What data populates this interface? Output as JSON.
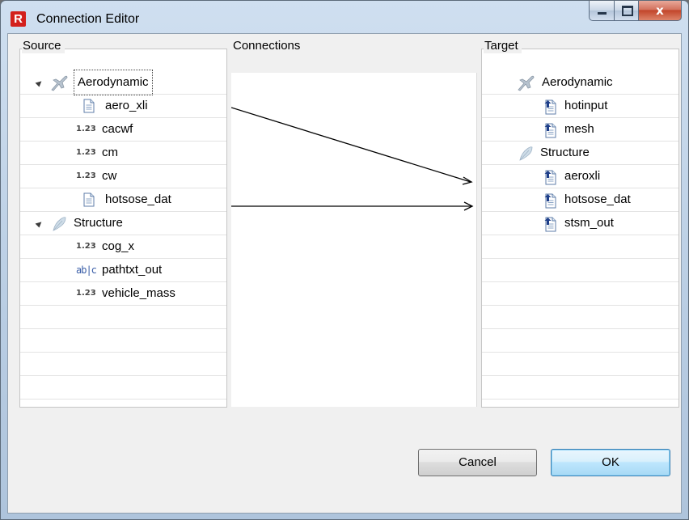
{
  "window": {
    "title": "Connection Editor",
    "app_icon_letter": "R",
    "close_glyph": "x"
  },
  "source": {
    "label": "Source",
    "items": [
      {
        "label": "Aerodynamic",
        "icon": "airplane-icon",
        "level": 0,
        "expanded": true,
        "focused": true
      },
      {
        "label": "aero_xli",
        "icon": "file-icon",
        "level": 1
      },
      {
        "label": "cacwf",
        "icon": "number-icon",
        "level": 1
      },
      {
        "label": "cm",
        "icon": "number-icon",
        "level": 1
      },
      {
        "label": "cw",
        "icon": "number-icon",
        "level": 1
      },
      {
        "label": "hotsose_dat",
        "icon": "file-icon",
        "level": 1
      },
      {
        "label": "Structure",
        "icon": "feather-icon",
        "level": 0,
        "expanded": true
      },
      {
        "label": "cog_x",
        "icon": "number-icon",
        "level": 1
      },
      {
        "label": "pathtxt_out",
        "icon": "text-icon",
        "level": 1
      },
      {
        "label": "vehicle_mass",
        "icon": "number-icon",
        "level": 1
      }
    ],
    "number_icon_text": "1.23",
    "text_icon_text": "ab|c"
  },
  "connections": {
    "label": "Connections",
    "links": [
      {
        "from": "aero_xli",
        "to": "aeroxli"
      },
      {
        "from": "hotsose_dat",
        "to": "hotsose_dat"
      }
    ]
  },
  "target": {
    "label": "Target",
    "items": [
      {
        "label": "Aerodynamic",
        "icon": "airplane-icon",
        "level": 0
      },
      {
        "label": "hotinput",
        "icon": "input-file-icon",
        "level": 1
      },
      {
        "label": "mesh",
        "icon": "input-file-icon",
        "level": 1
      },
      {
        "label": "Structure",
        "icon": "feather-icon",
        "level": 0
      },
      {
        "label": "aeroxli",
        "icon": "input-file-icon",
        "level": 1
      },
      {
        "label": "hotsose_dat",
        "icon": "input-file-icon",
        "level": 1
      },
      {
        "label": "stsm_out",
        "icon": "input-file-icon",
        "level": 1
      }
    ]
  },
  "buttons": {
    "cancel": "Cancel",
    "ok": "OK"
  }
}
